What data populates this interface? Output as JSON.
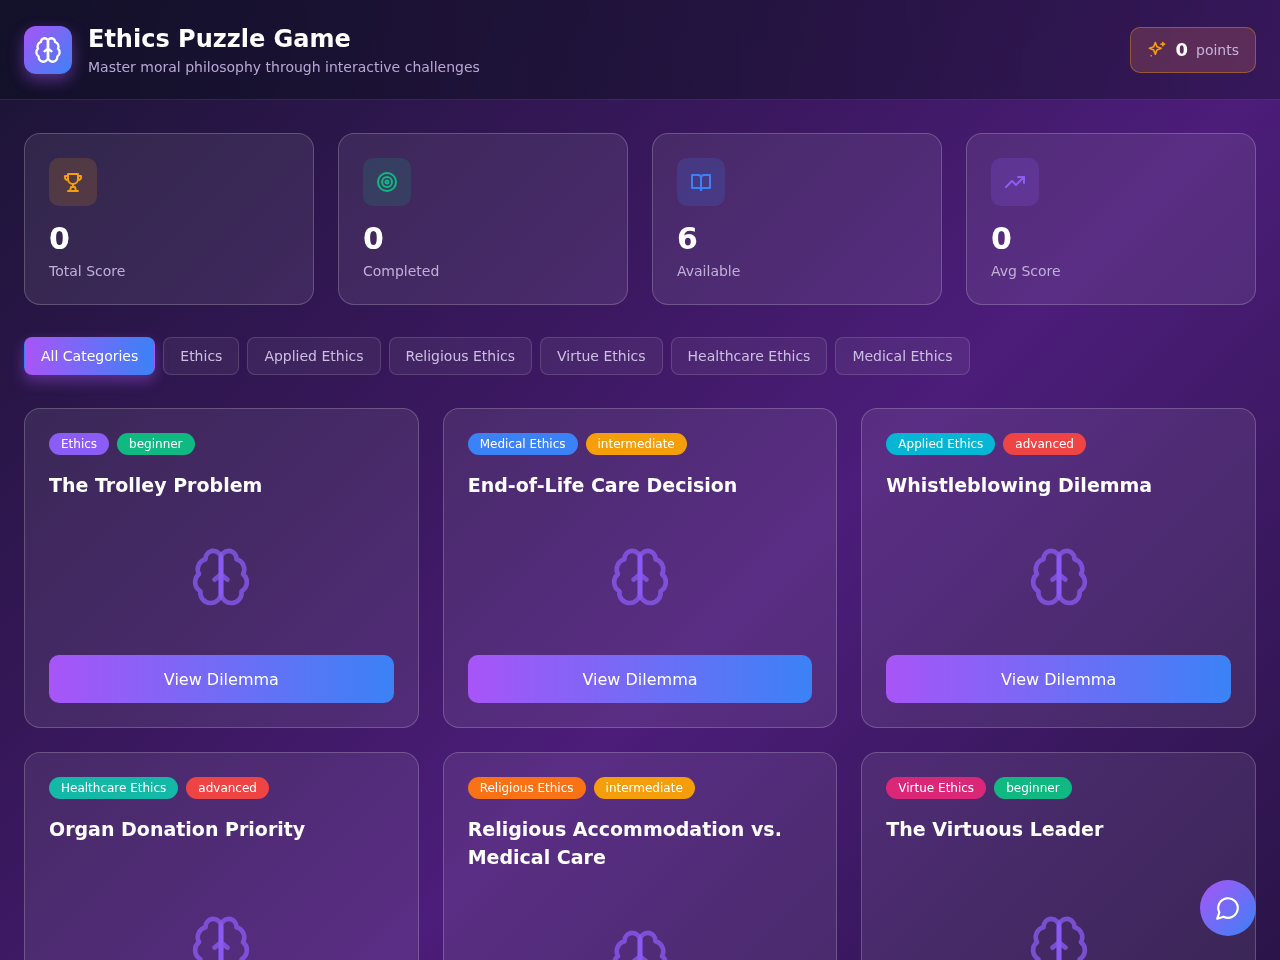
{
  "header": {
    "title": "Ethics Puzzle Game",
    "subtitle": "Master moral philosophy through interactive challenges",
    "points": {
      "value": "0",
      "label": "points"
    }
  },
  "stats": [
    {
      "kind": "trophy",
      "value": "0",
      "label": "Total Score"
    },
    {
      "kind": "target",
      "value": "0",
      "label": "Completed"
    },
    {
      "kind": "book",
      "value": "6",
      "label": "Available"
    },
    {
      "kind": "trend",
      "value": "0",
      "label": "Avg Score"
    }
  ],
  "filters": [
    {
      "label": "All Categories",
      "selected": true
    },
    {
      "label": "Ethics",
      "selected": false
    },
    {
      "label": "Applied Ethics",
      "selected": false
    },
    {
      "label": "Religious Ethics",
      "selected": false
    },
    {
      "label": "Virtue Ethics",
      "selected": false
    },
    {
      "label": "Healthcare Ethics",
      "selected": false
    },
    {
      "label": "Medical Ethics",
      "selected": false
    }
  ],
  "dilemmas": [
    {
      "tags": [
        {
          "label": "Ethics",
          "color": "#8b5cf6"
        },
        {
          "label": "beginner",
          "color": "#10b981"
        }
      ],
      "title": "The Trolley Problem",
      "button": "View Dilemma"
    },
    {
      "tags": [
        {
          "label": "Medical Ethics",
          "color": "#3b82f6"
        },
        {
          "label": "intermediate",
          "color": "#f59e0b"
        }
      ],
      "title": "End-of-Life Care Decision",
      "button": "View Dilemma"
    },
    {
      "tags": [
        {
          "label": "Applied Ethics",
          "color": "#06b6d4"
        },
        {
          "label": "advanced",
          "color": "#ef4444"
        }
      ],
      "title": "Whistleblowing Dilemma",
      "button": "View Dilemma"
    },
    {
      "tags": [
        {
          "label": "Healthcare Ethics",
          "color": "#14b8a6"
        },
        {
          "label": "advanced",
          "color": "#ef4444"
        }
      ],
      "title": "Organ Donation Priority"
    },
    {
      "tags": [
        {
          "label": "Religious Ethics",
          "color": "#f97316"
        },
        {
          "label": "intermediate",
          "color": "#f59e0b"
        }
      ],
      "title": "Religious Accommodation vs. Medical Care"
    },
    {
      "tags": [
        {
          "label": "Virtue Ethics",
          "color": "#db2777"
        },
        {
          "label": "beginner",
          "color": "#10b981"
        }
      ],
      "title": "The Virtuous Leader"
    }
  ]
}
